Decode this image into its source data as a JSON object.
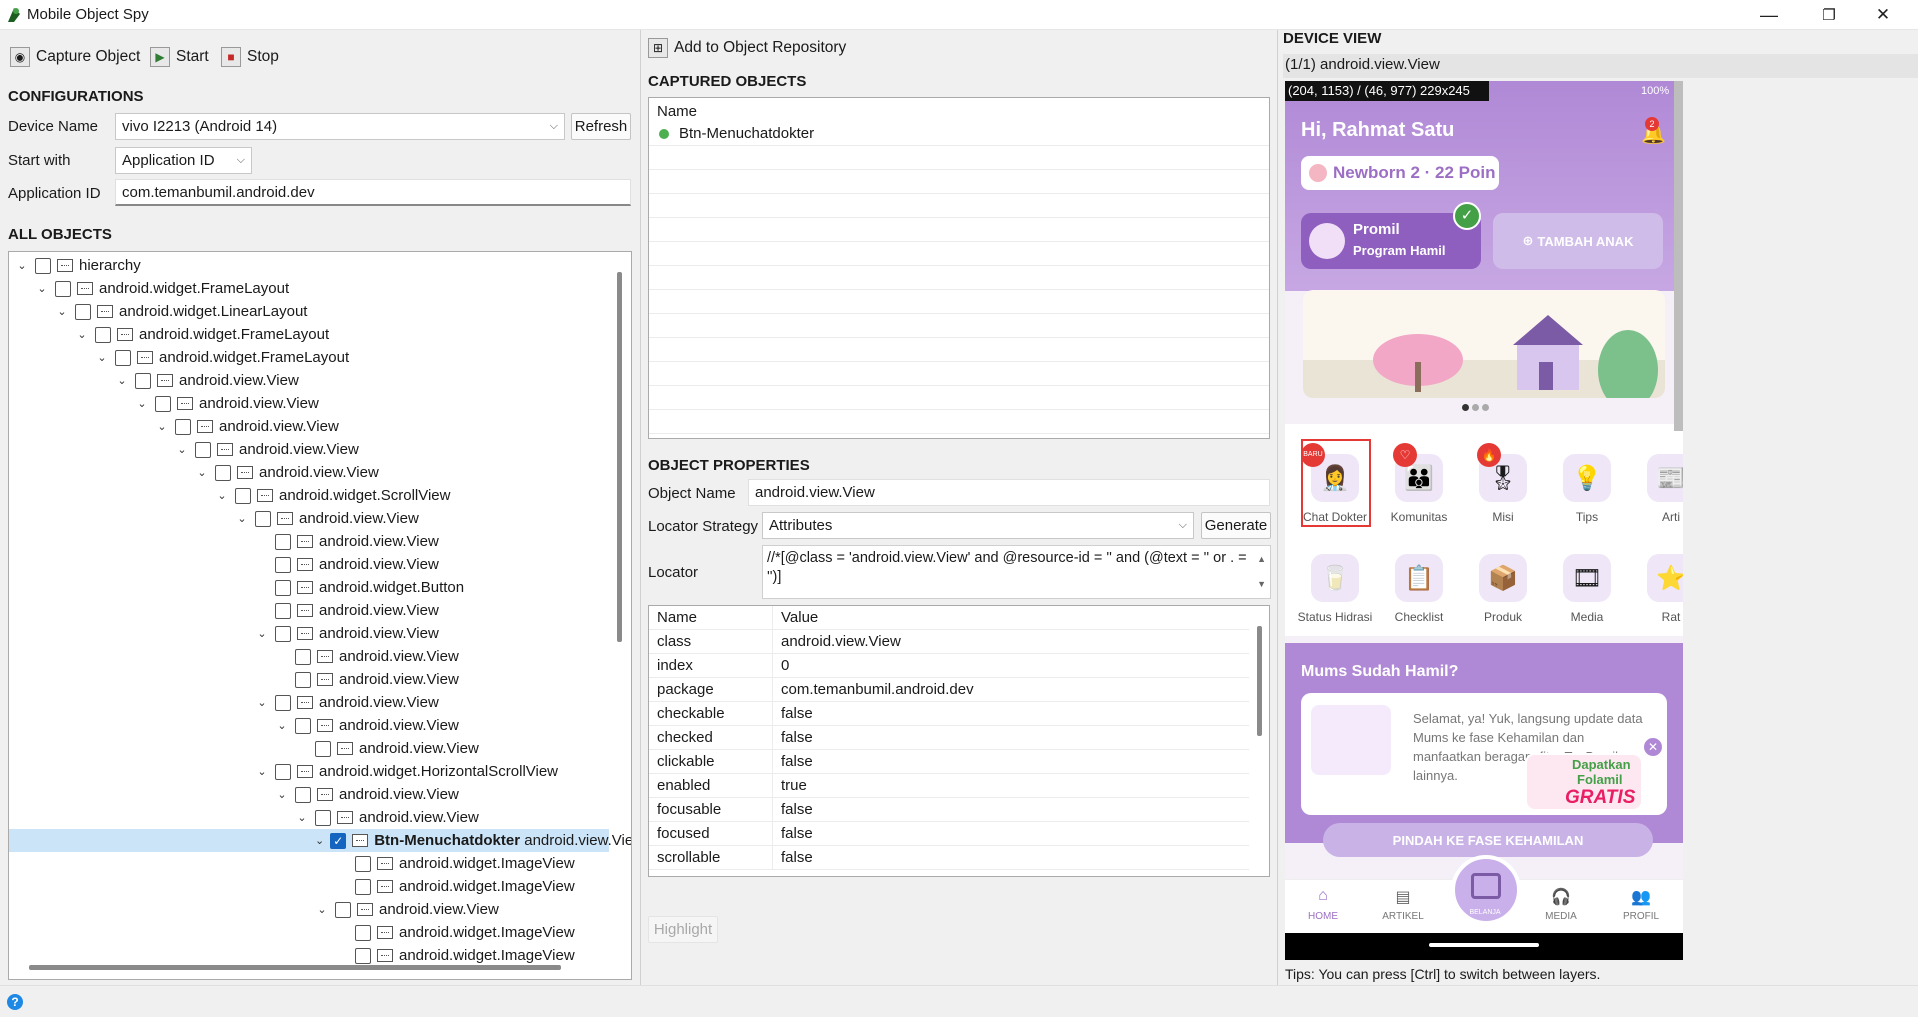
{
  "window": {
    "title": "Mobile Object Spy",
    "minimize": "—",
    "maximize": "❐",
    "close": "✕"
  },
  "toolbar": {
    "capture": "Capture Object",
    "start": "Start",
    "stop": "Stop",
    "add_repo": "Add to Object Repository"
  },
  "config": {
    "title": "CONFIGURATIONS",
    "device_label": "Device Name",
    "device_value": "vivo I2213 (Android 14)",
    "refresh": "Refresh",
    "start_label": "Start with",
    "start_value": "Application ID",
    "appid_label": "Application ID",
    "appid_value": "com.temanbumil.android.dev"
  },
  "all_objects": {
    "title": "ALL OBJECTS",
    "rows": [
      {
        "label": "hierarchy",
        "depth": 0,
        "exp": "open"
      },
      {
        "label": "android.widget.FrameLayout",
        "depth": 1,
        "exp": "open"
      },
      {
        "label": "android.widget.LinearLayout",
        "depth": 2,
        "exp": "open"
      },
      {
        "label": "android.widget.FrameLayout",
        "depth": 3,
        "exp": "open"
      },
      {
        "label": "android.widget.FrameLayout",
        "depth": 4,
        "exp": "open"
      },
      {
        "label": "android.view.View",
        "depth": 5,
        "exp": "open"
      },
      {
        "label": "android.view.View",
        "depth": 6,
        "exp": "open"
      },
      {
        "label": "android.view.View",
        "depth": 7,
        "exp": "open"
      },
      {
        "label": "android.view.View",
        "depth": 8,
        "exp": "open"
      },
      {
        "label": "android.view.View",
        "depth": 9,
        "exp": "open"
      },
      {
        "label": "android.widget.ScrollView",
        "depth": 10,
        "exp": "open"
      },
      {
        "label": "android.view.View",
        "depth": 11,
        "exp": "open"
      },
      {
        "label": "android.view.View",
        "depth": 12,
        "exp": "none"
      },
      {
        "label": "android.view.View",
        "depth": 12,
        "exp": "none"
      },
      {
        "label": "android.widget.Button",
        "depth": 12,
        "exp": "none"
      },
      {
        "label": "android.view.View",
        "depth": 12,
        "exp": "none"
      },
      {
        "label": "android.view.View",
        "depth": 12,
        "exp": "open"
      },
      {
        "label": "android.view.View",
        "depth": 13,
        "exp": "none"
      },
      {
        "label": "android.view.View",
        "depth": 13,
        "exp": "none"
      },
      {
        "label": "android.view.View",
        "depth": 12,
        "exp": "open"
      },
      {
        "label": "android.view.View",
        "depth": 13,
        "exp": "open"
      },
      {
        "label": "android.view.View",
        "depth": 14,
        "exp": "none"
      },
      {
        "label": "android.widget.HorizontalScrollView",
        "depth": 12,
        "exp": "open"
      },
      {
        "label": "android.view.View",
        "depth": 13,
        "exp": "open"
      },
      {
        "label": "android.view.View",
        "depth": 14,
        "exp": "open"
      },
      {
        "label": "Btn-Menuchatdokter",
        "suffix": " android.view.View",
        "depth": 15,
        "exp": "open",
        "checked": true,
        "selected": true
      },
      {
        "label": "android.widget.ImageView",
        "depth": 16,
        "exp": "none"
      },
      {
        "label": "android.widget.ImageView",
        "depth": 16,
        "exp": "none"
      },
      {
        "label": "android.view.View",
        "depth": 15,
        "exp": "open"
      },
      {
        "label": "android.widget.ImageView",
        "depth": 16,
        "exp": "none"
      },
      {
        "label": "android.widget.ImageView",
        "depth": 16,
        "exp": "none"
      }
    ]
  },
  "captured": {
    "title": "CAPTURED OBJECTS",
    "header": "Name",
    "items": [
      "Btn-Menuchatdokter"
    ]
  },
  "properties": {
    "title": "OBJECT PROPERTIES",
    "name_label": "Object Name",
    "name_value": "android.view.View",
    "strategy_label": "Locator Strategy",
    "strategy_value": "Attributes",
    "generate": "Generate",
    "locator_label": "Locator",
    "locator_value": "//*[@class = 'android.view.View' and @resource-id = '' and (@text = '' or . = '')]",
    "col_name": "Name",
    "col_value": "Value",
    "rows": [
      [
        "class",
        "android.view.View"
      ],
      [
        "index",
        "0"
      ],
      [
        "package",
        "com.temanbumil.android.dev"
      ],
      [
        "checkable",
        "false"
      ],
      [
        "checked",
        "false"
      ],
      [
        "clickable",
        "false"
      ],
      [
        "enabled",
        "true"
      ],
      [
        "focusable",
        "false"
      ],
      [
        "focused",
        "false"
      ],
      [
        "scrollable",
        "false"
      ]
    ],
    "highlight": "Highlight"
  },
  "device": {
    "title": "DEVICE VIEW",
    "layer_info": "(1/1) android.view.View",
    "coords": "(204, 1153) / (46, 977) 229x245",
    "status_right": "100%",
    "greeting": "Hi, Rahmat Satu",
    "bell_badge": "2",
    "points": "Newborn 2 · 22 Poin",
    "promil_title": "Promil",
    "promil_sub": "Program Hamil",
    "tambah": "TAMBAH ANAK",
    "menu_row1": [
      "Chat Dokter",
      "Komunitas",
      "Misi",
      "Tips",
      "Arti"
    ],
    "menu_row2": [
      "Status Hidrasi",
      "Checklist",
      "Produk",
      "Media",
      "Rat"
    ],
    "badge_baru": "BARU",
    "mums_title": "Mums Sudah Hamil?",
    "mums_text": "Selamat, ya! Yuk, langsung update data Mums ke fase Kehamilan dan manfaatkan beragam fitur T... Bumil lainnya.",
    "promo_line1": "Dapatkan",
    "promo_line2": "Folamil",
    "promo_line3": "GRATIS",
    "pindah_btn": "PINDAH KE FASE KEHAMILAN",
    "nav": [
      "HOME",
      "ARTIKEL",
      "BELANJA",
      "MEDIA",
      "PROFIL"
    ],
    "accent": "#9c6fc4"
  },
  "status_tip": "Tips: You can press [Ctrl] to switch between layers.",
  "help_icon": "?"
}
